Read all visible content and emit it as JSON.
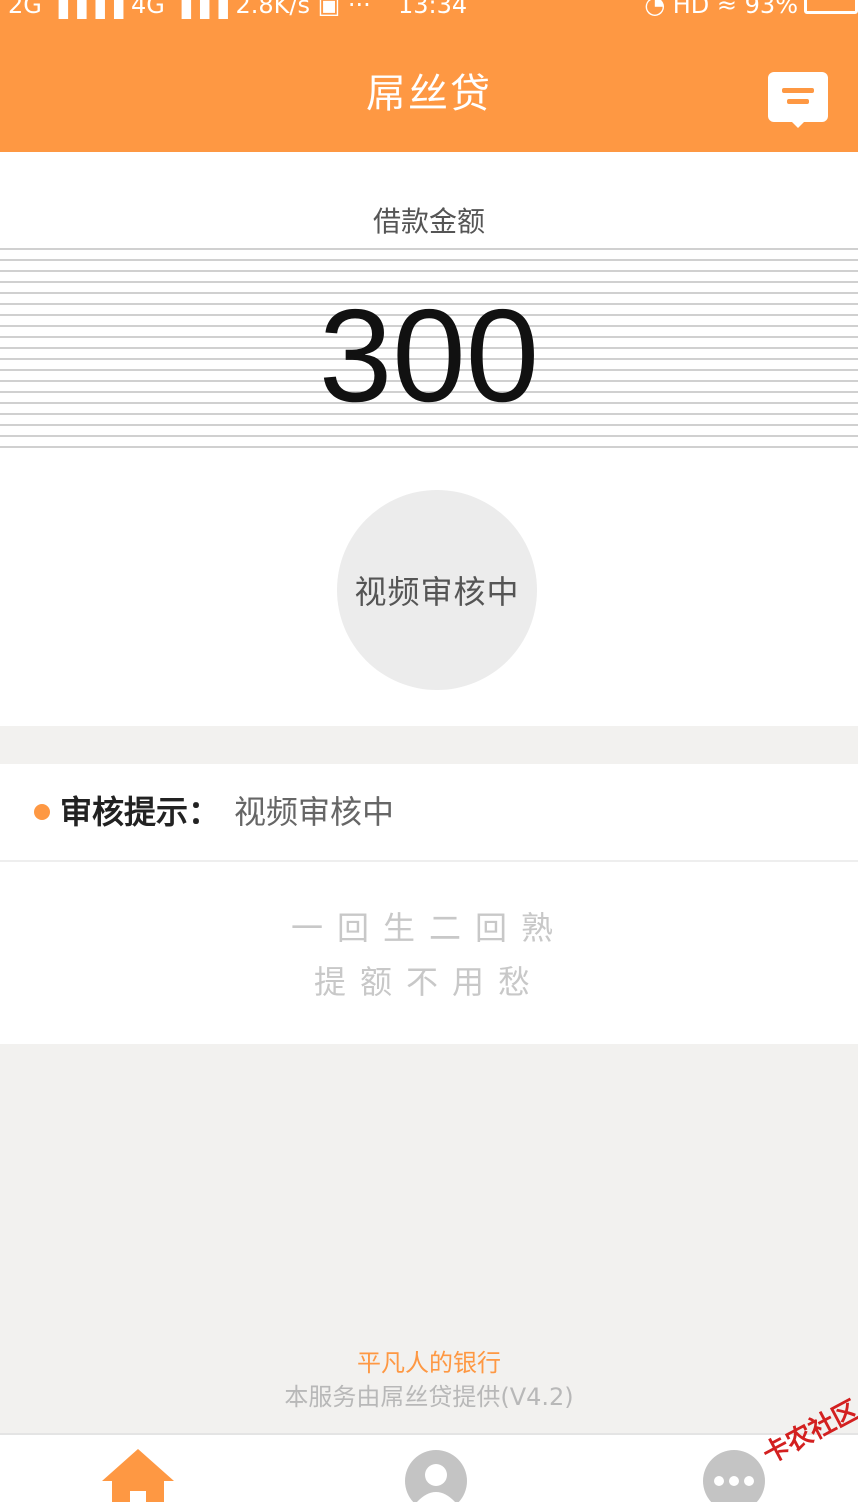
{
  "status_bar": {
    "left": "2G ▐▐▐▐ 4G ▐▐▐ 2.8K/s ▣ ···",
    "time": "13:34",
    "right": "◔ HD ≈ 93%"
  },
  "header": {
    "title": "屌丝贷",
    "message_icon": "message-icon"
  },
  "loan": {
    "label": "借款金额",
    "amount": "300",
    "status": "视频审核中"
  },
  "review_tip": {
    "label": "审核提示：",
    "value": "视频审核中"
  },
  "slogan": {
    "line1": "一回生二回熟",
    "line2": "提额不用愁"
  },
  "footer": {
    "tagline": "平凡人的银行",
    "provider": "本服务由屌丝贷提供(V4.2)"
  },
  "tabs": [
    {
      "icon": "home-icon",
      "active": true
    },
    {
      "icon": "user-icon",
      "active": false
    },
    {
      "icon": "more-icon",
      "active": false
    }
  ],
  "colors": {
    "accent": "#fe9843",
    "background": "#f2f1ef",
    "inactive_icon": "#c4c4c4"
  },
  "watermark": "卡农社区"
}
